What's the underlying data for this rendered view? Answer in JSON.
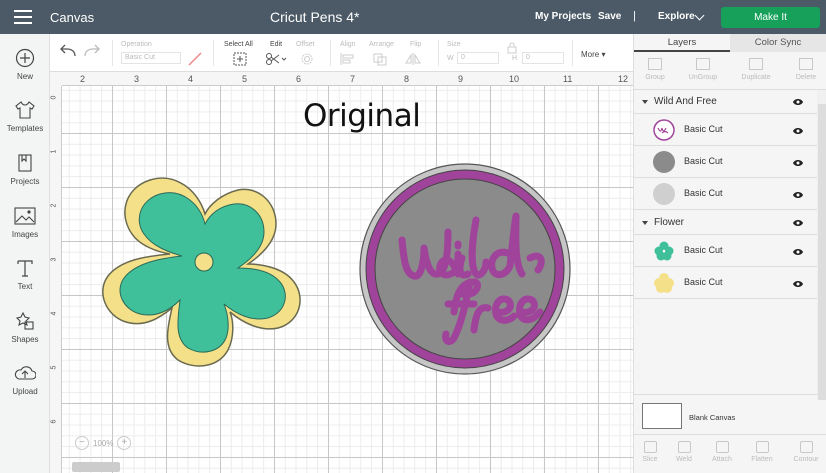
{
  "header": {
    "section": "Canvas",
    "title": "Cricut Pens 4*",
    "my_projects": "My Projects",
    "save": "Save",
    "separator": "|",
    "explore": "Explore",
    "make_it": "Make It"
  },
  "leftbar": {
    "items": [
      {
        "label": "New"
      },
      {
        "label": "Templates"
      },
      {
        "label": "Projects"
      },
      {
        "label": "Images"
      },
      {
        "label": "Text"
      },
      {
        "label": "Shapes"
      },
      {
        "label": "Upload"
      }
    ]
  },
  "toolbar": {
    "operation_label": "Operation",
    "operation_value": "Basic Cut",
    "select_all": "Select All",
    "edit": "Edit",
    "offset": "Offset",
    "align": "Align",
    "arrange": "Arrange",
    "flip": "Flip",
    "size": "Size",
    "w": "W",
    "h": "H",
    "w_val": "0",
    "h_val": "0",
    "more": "More ▾"
  },
  "canvas": {
    "ruler_top": [
      "2",
      "3",
      "4",
      "5",
      "6",
      "7",
      "8",
      "9",
      "10",
      "11",
      "12"
    ],
    "ruler_left": [
      "0",
      "1",
      "2",
      "3",
      "4",
      "5",
      "6"
    ],
    "label": "Original",
    "zoom": "100%",
    "zoom_minus": "−",
    "zoom_plus": "+",
    "colors": {
      "flower_back": "#f5e08a",
      "flower_front": "#3fbf9a",
      "circle_back": "#c6c6c6",
      "circle_front": "#8b8b8b",
      "wildfree": "#a0439a"
    }
  },
  "panel": {
    "tabs": [
      "Layers",
      "Color Sync"
    ],
    "actions": [
      "Group",
      "UnGroup",
      "Duplicate",
      "Delete"
    ],
    "groups": [
      {
        "name": "Wild And Free",
        "rows": [
          "Basic Cut",
          "Basic Cut",
          "Basic Cut"
        ]
      },
      {
        "name": "Flower",
        "rows": [
          "Basic Cut",
          "Basic Cut"
        ]
      }
    ],
    "blank_canvas": "Blank Canvas",
    "bottom": [
      "Slice",
      "Weld",
      "Attach",
      "Flatten",
      "Contour"
    ]
  }
}
